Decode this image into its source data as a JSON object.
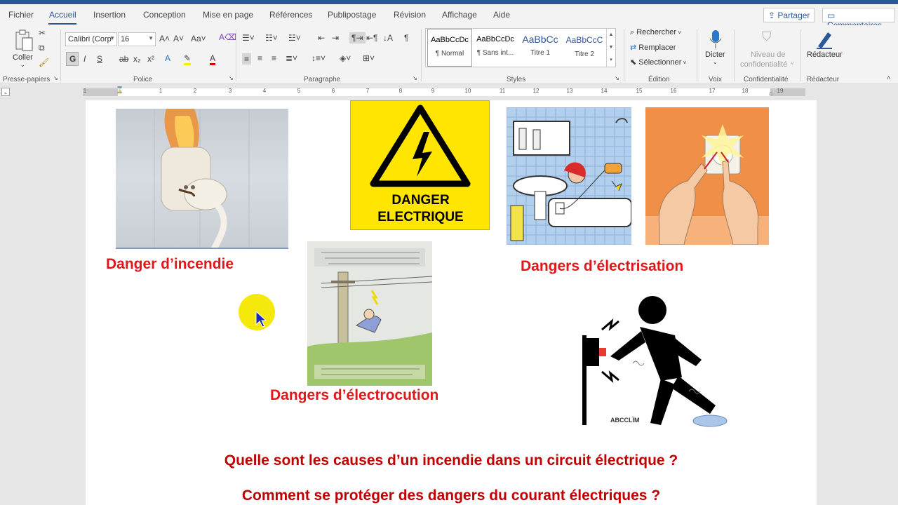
{
  "menu": {
    "tabs": [
      "Fichier",
      "Accueil",
      "Insertion",
      "Conception",
      "Mise en page",
      "Références",
      "Publipostage",
      "Révision",
      "Affichage",
      "Aide"
    ],
    "share_label": "Partager",
    "comments_label": "Commentaires"
  },
  "ribbon": {
    "clipboard": {
      "paste_label": "Coller",
      "group_label": "Presse-papiers"
    },
    "font": {
      "name": "Calibri (Corp",
      "size": "16",
      "group_label": "Police",
      "bold": "G",
      "italic": "I",
      "underline": "S",
      "strike": "ab",
      "sub": "x₂",
      "sup": "x²"
    },
    "paragraph": {
      "group_label": "Paragraphe"
    },
    "styles": {
      "group_label": "Styles",
      "items": [
        {
          "sample": "AaBbCcDc",
          "name": "¶ Normal"
        },
        {
          "sample": "AaBbCcDc",
          "name": "¶ Sans int..."
        },
        {
          "sample": "AaBbCc",
          "name": "Titre 1"
        },
        {
          "sample": "AaBbCcC",
          "name": "Titre 2"
        }
      ]
    },
    "editing": {
      "find": "Rechercher",
      "replace": "Remplacer",
      "select": "Sélectionner",
      "group_label": "Édition"
    },
    "voice": {
      "dictate": "Dicter",
      "group_label": "Voix"
    },
    "privacy": {
      "level": "Niveau de",
      "level2": "confidentialité",
      "group_label": "Confidentialité"
    },
    "editor": {
      "label": "Rédacteur",
      "group_label": "Rédacteur"
    }
  },
  "ruler": {
    "numbers": [
      "1",
      "1",
      "2",
      "3",
      "4",
      "5",
      "6",
      "7",
      "8",
      "9",
      "10",
      "11",
      "12",
      "13",
      "14",
      "15",
      "16",
      "17",
      "18",
      "19"
    ]
  },
  "document": {
    "sign_line1": "DANGER",
    "sign_line2": "ELECTRIQUE",
    "caption_fire": "Danger d’incendie",
    "caption_electrisation": "Dangers d’électrisation",
    "caption_electrocution": "Dangers d’électrocution",
    "logo_text": "ABCCLÏM",
    "question1": "Quelle sont les causes d’un incendie dans un circuit électrique ?",
    "question2": "Comment se protéger des dangers du courant électriques ?"
  },
  "colors": {
    "accent": "#2b579a",
    "caption_red": "#e0161b",
    "question_red": "#c00000",
    "sign_yellow": "#ffe500"
  }
}
